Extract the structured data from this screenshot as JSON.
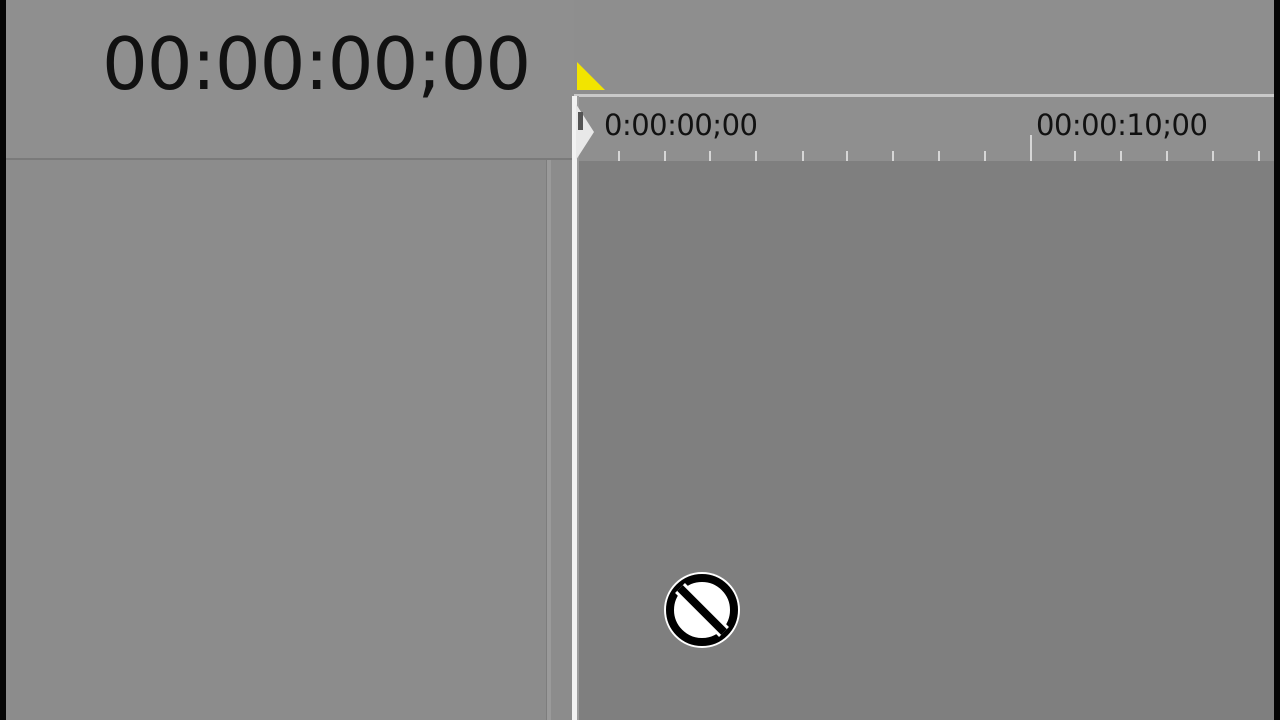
{
  "header": {
    "timecode": "00:00:00;00"
  },
  "ruler": {
    "labels": [
      "0:00:00;00",
      "00:00:10;00"
    ]
  },
  "colors": {
    "marker": "#f2e400",
    "playhead": "#f2f2f2",
    "panel": "#8c8c8c",
    "timeline": "#7f7f7f"
  },
  "icons": {
    "cursor": "not-allowed-cursor-icon",
    "marker": "marker-flag-icon"
  }
}
